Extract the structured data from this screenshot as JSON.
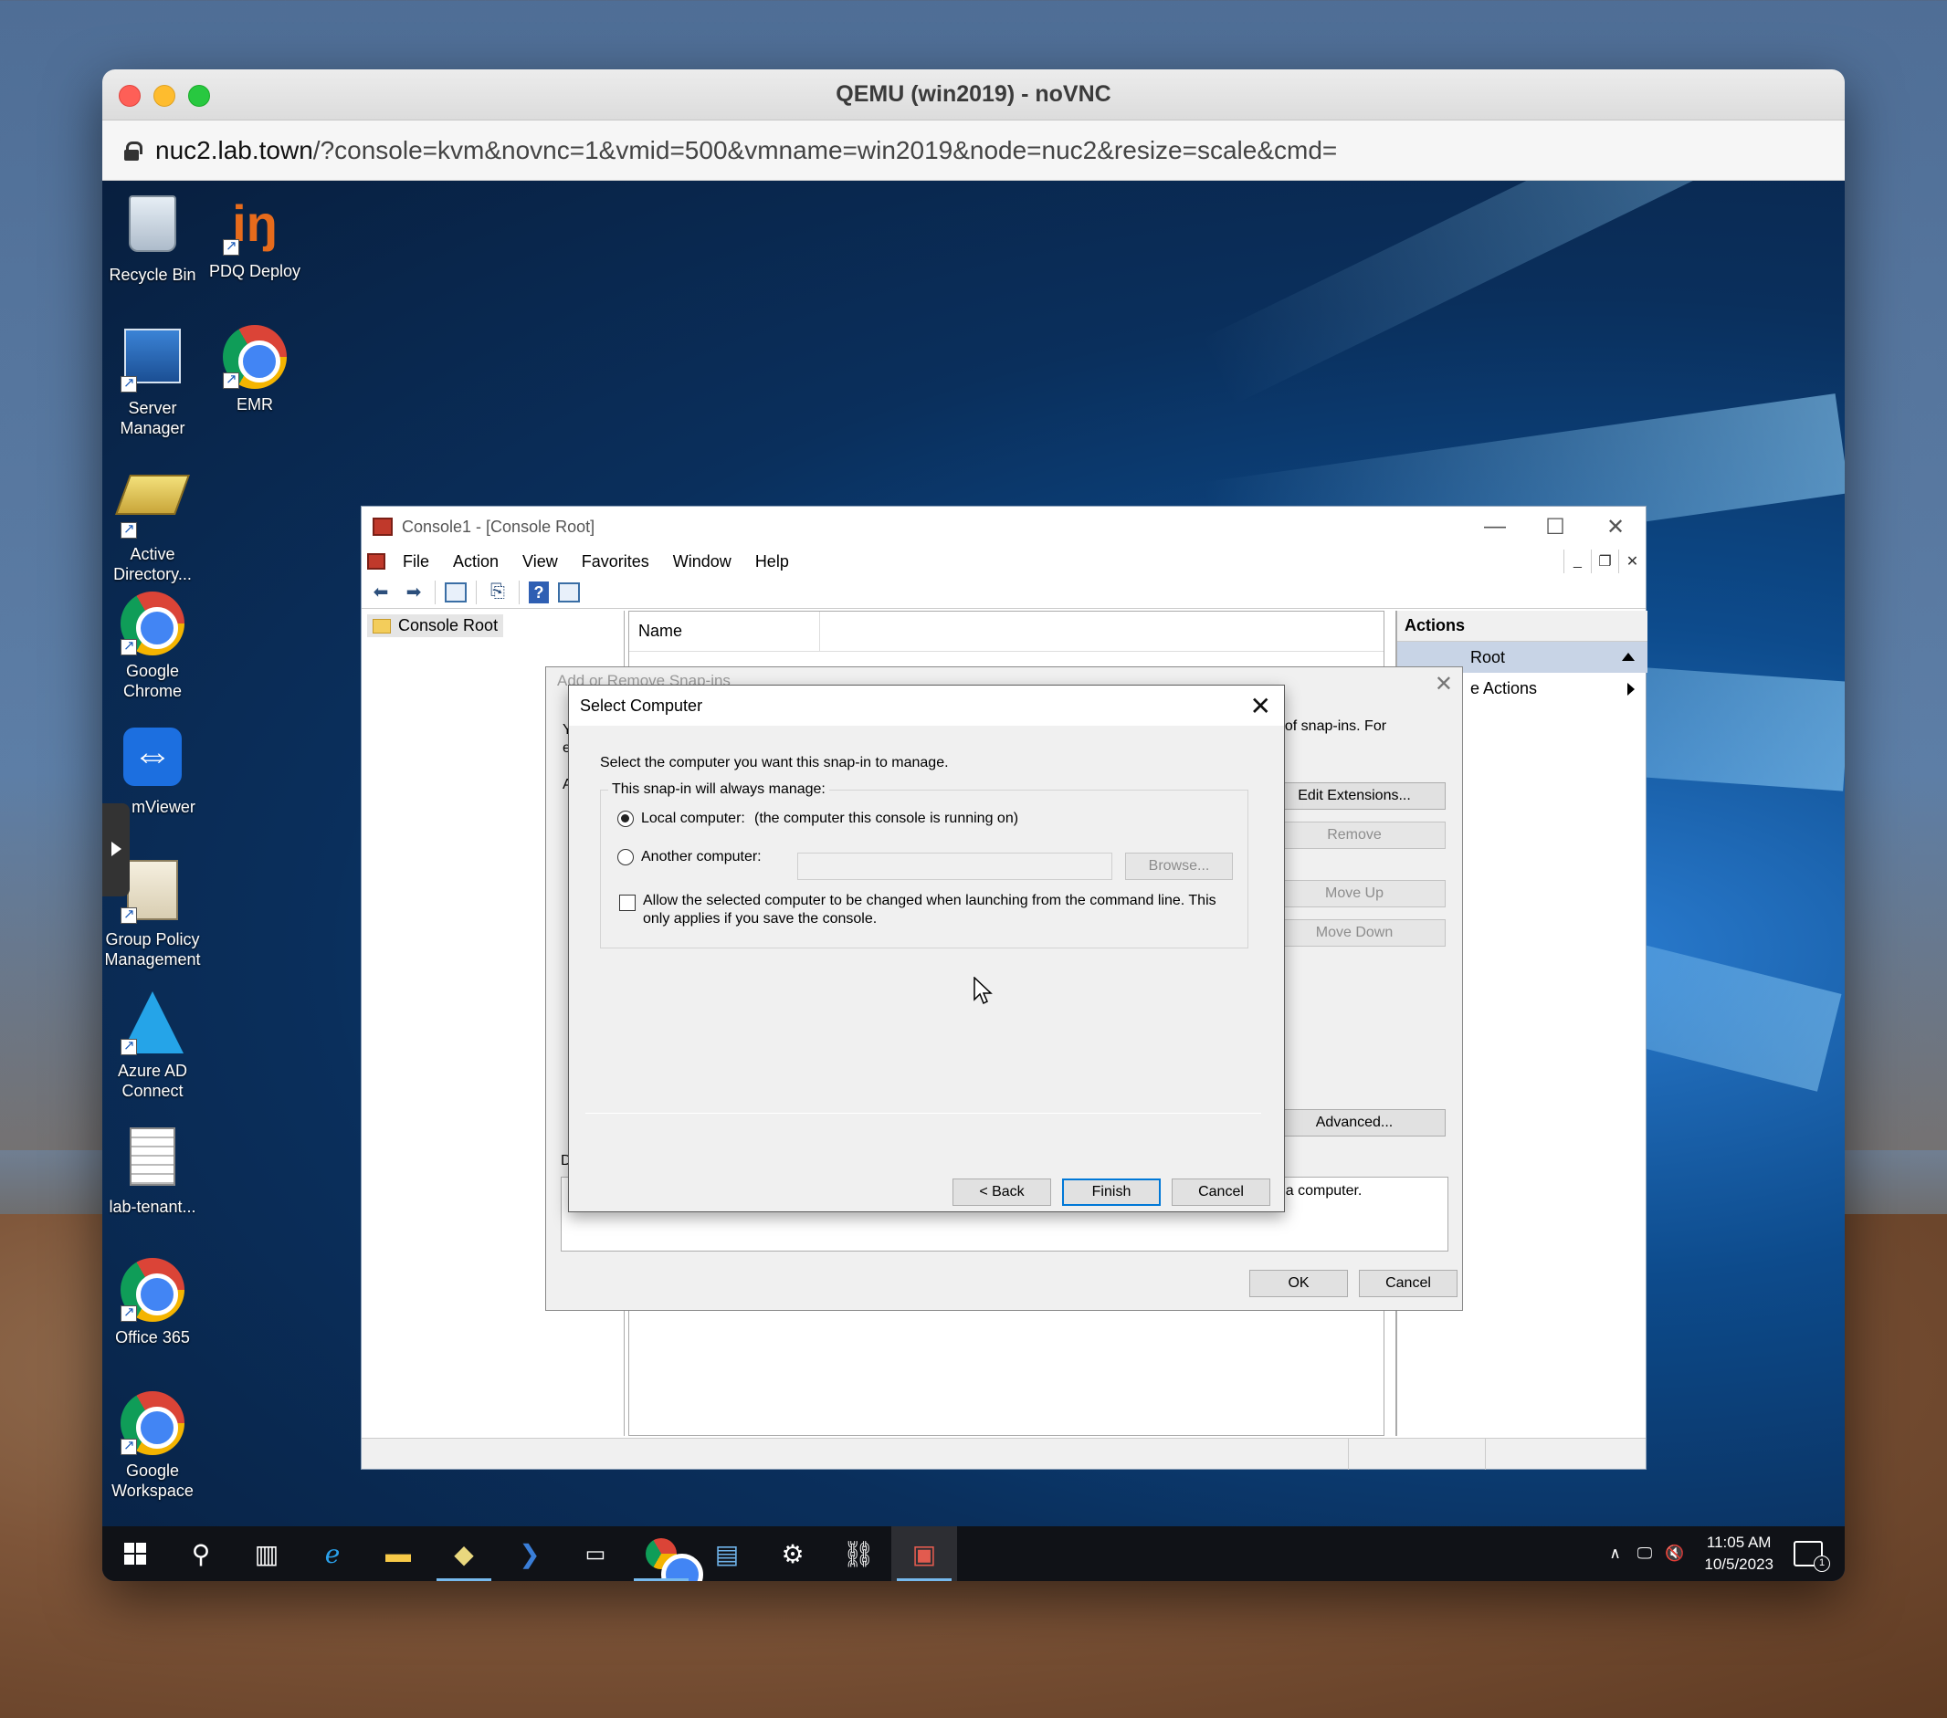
{
  "mac_window": {
    "title": "QEMU (win2019) - noVNC",
    "url_host": "nuc2.lab.town",
    "url_rest": "/?console=kvm&novnc=1&vmid=500&vmname=win2019&node=nuc2&resize=scale&cmd="
  },
  "desktop_icons": [
    {
      "label": "Recycle Bin",
      "icon": "recycle-bin-icon"
    },
    {
      "label": "PDQ Deploy",
      "icon": "pdq-deploy-icon"
    },
    {
      "label": "Server Manager",
      "icon": "server-manager-icon"
    },
    {
      "label": "EMR",
      "icon": "chrome-icon"
    },
    {
      "label": "Active Directory...",
      "icon": "active-directory-icon"
    },
    {
      "label": "Google Chrome",
      "icon": "chrome-icon"
    },
    {
      "label": "mViewer",
      "icon": "teamviewer-icon"
    },
    {
      "label": "Group Policy Management",
      "icon": "group-policy-icon"
    },
    {
      "label": "Azure AD Connect",
      "icon": "azure-ad-icon"
    },
    {
      "label": "lab-tenant...",
      "icon": "text-document-icon"
    },
    {
      "label": "Office 365",
      "icon": "chrome-icon"
    },
    {
      "label": "Google Workspace",
      "icon": "chrome-icon"
    }
  ],
  "mmc": {
    "title": "Console1 - [Console Root]",
    "menu": [
      "File",
      "Action",
      "View",
      "Favorites",
      "Window",
      "Help"
    ],
    "tree_root": "Console Root",
    "name_column": "Name",
    "actions_header": "Actions",
    "actions_selected": "Root",
    "actions_more": "e Actions"
  },
  "snapins_dialog": {
    "title": "Add or Remove Snap-ins",
    "desc_fragment": "t of snap-ins. For",
    "edit_extensions": "Edit Extensions...",
    "remove": "Remove",
    "move_up": "Move Up",
    "move_down": "Move Down",
    "advanced": "Advanced...",
    "description_fragment": "r a computer.",
    "ok": "OK",
    "cancel": "Cancel",
    "frag_y": "Y",
    "frag_e": "e",
    "frag_a": "A",
    "frag_d": "D"
  },
  "select_computer": {
    "title": "Select Computer",
    "prompt": "Select the computer you want this snap-in to manage.",
    "group_label": "This snap-in will always manage:",
    "local_label": "Local computer:",
    "local_hint": "(the computer this console is running on)",
    "local_checked": true,
    "another_label": "Another computer:",
    "another_value": "",
    "browse": "Browse...",
    "allow_change_line1": "Allow the selected computer to be changed when launching from the command line.  This",
    "allow_change_line2": "only applies if you save the console.",
    "allow_checked": false,
    "back": "< Back",
    "finish": "Finish",
    "cancel": "Cancel"
  },
  "taskbar": {
    "items": [
      "start-icon",
      "search-icon",
      "task-view-icon",
      "internet-explorer-icon",
      "file-explorer-icon",
      "active-directory-icon",
      "powershell-icon",
      "command-prompt-icon",
      "chrome-icon",
      "server-icon",
      "settings-icon",
      "network-icon",
      "mmc-icon"
    ],
    "time": "11:05 AM",
    "date": "10/5/2023",
    "notifications": "1"
  }
}
